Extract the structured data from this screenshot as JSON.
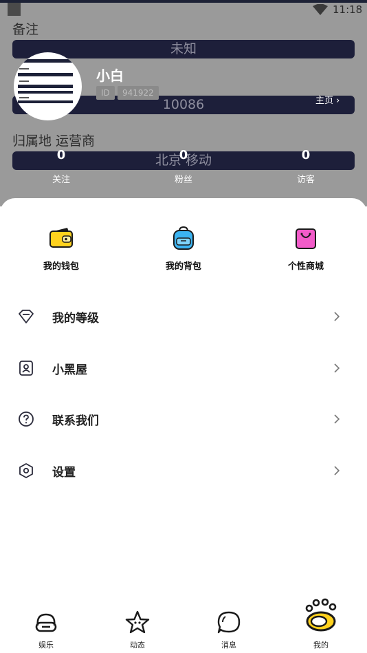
{
  "status_bar": {
    "time": "11:18"
  },
  "profile_bg": {
    "remark_label": "备注",
    "remark_value": "未知",
    "phone_value": "10086",
    "region_label": "归属地 运营商",
    "region_value": "北京 移动"
  },
  "profile": {
    "nickname": "小白",
    "id_label": "ID",
    "id_value": "941922",
    "homepage_label": "主页 ›"
  },
  "stats": [
    {
      "count": "0",
      "label": "关注"
    },
    {
      "count": "0",
      "label": "粉丝"
    },
    {
      "count": "0",
      "label": "访客"
    }
  ],
  "quick_actions": [
    {
      "label": "我的钱包",
      "icon": "wallet-icon",
      "color": "#FFD21E"
    },
    {
      "label": "我的背包",
      "icon": "backpack-icon",
      "color": "#3BB4F2"
    },
    {
      "label": "个性商城",
      "icon": "shopping-bag-icon",
      "color": "#F25BC9"
    }
  ],
  "menu": [
    {
      "label": "我的等级",
      "icon": "diamond-icon"
    },
    {
      "label": "小黑屋",
      "icon": "contact-card-icon"
    },
    {
      "label": "联系我们",
      "icon": "help-circle-icon"
    },
    {
      "label": "设置",
      "icon": "hexagon-settings-icon"
    }
  ],
  "tabs": [
    {
      "label": "娱乐",
      "icon": "entertainment-icon"
    },
    {
      "label": "动态",
      "icon": "star-icon"
    },
    {
      "label": "消息",
      "icon": "chat-bubble-icon"
    },
    {
      "label": "我的",
      "icon": "paw-icon",
      "active": true
    }
  ],
  "colors": {
    "dark_navy": "#1D1F3A",
    "overlay_gray": "#9A9A9A",
    "accent_yellow": "#FFD21E"
  }
}
